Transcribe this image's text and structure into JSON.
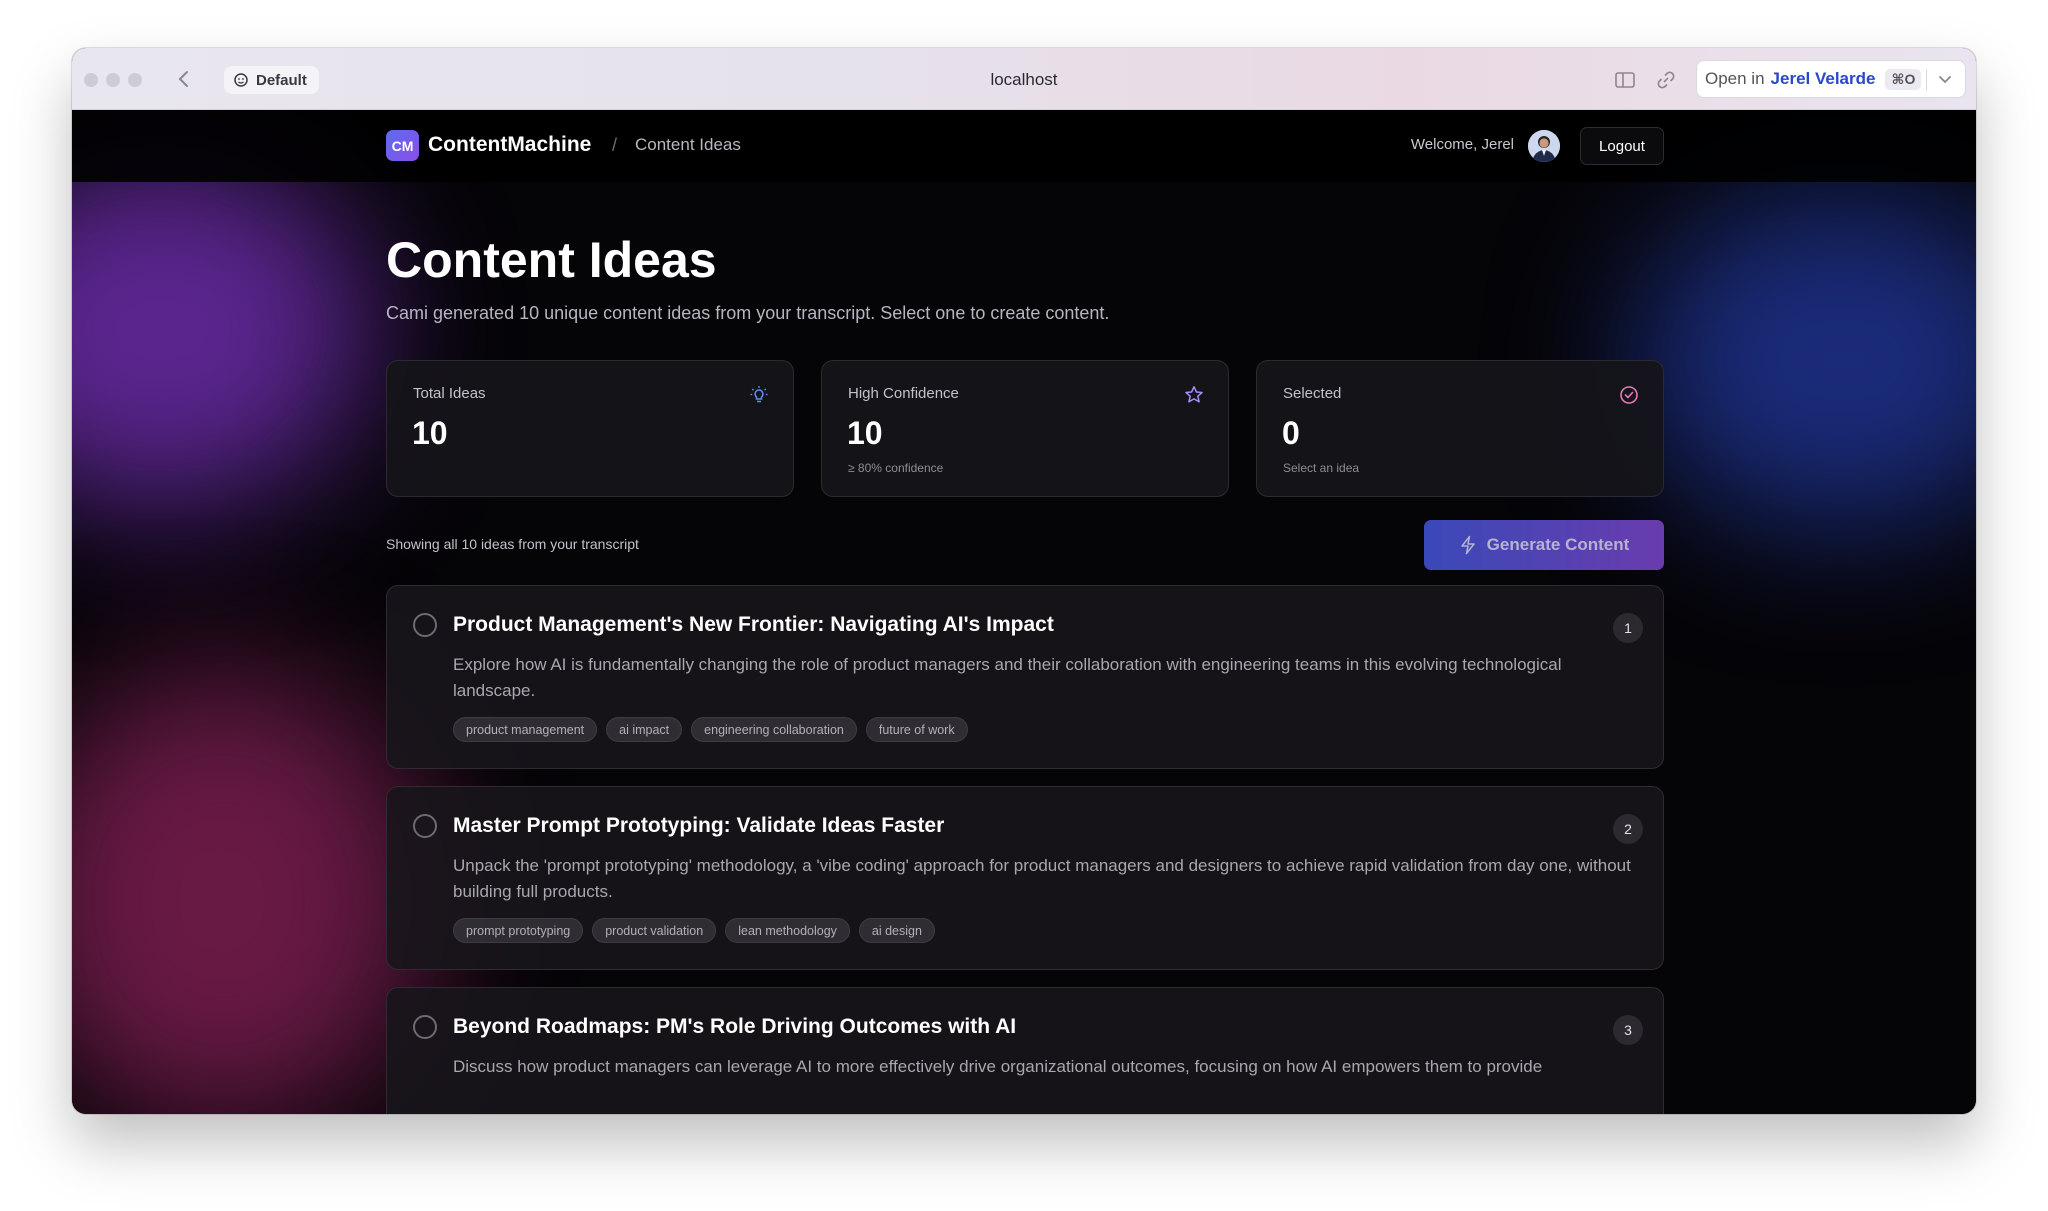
{
  "browser": {
    "profile_label": "Default",
    "url": "localhost",
    "open_in_prefix": "Open in",
    "open_in_name": "Jerel Velarde",
    "open_in_shortcut": "⌘O"
  },
  "header": {
    "logo_text": "CM",
    "brand": "ContentMachine",
    "separator": "/",
    "breadcrumb": "Content Ideas",
    "welcome": "Welcome, Jerel",
    "logout_label": "Logout"
  },
  "page": {
    "title": "Content Ideas",
    "subtitle": "Cami generated 10 unique content ideas from your transcript. Select one to create content."
  },
  "stats": [
    {
      "label": "Total Ideas",
      "value": "10",
      "note": "",
      "icon": "lightbulb-icon",
      "icon_color": "#5b8def"
    },
    {
      "label": "High Confidence",
      "value": "10",
      "note": "≥ 80% confidence",
      "icon": "star-icon",
      "icon_color": "#a78bfa"
    },
    {
      "label": "Selected",
      "value": "0",
      "note": "Select an idea",
      "icon": "check-circle-icon",
      "icon_color": "#e879b9"
    }
  ],
  "toolbar": {
    "showing_text": "Showing all 10 ideas from your transcript",
    "generate_label": "Generate Content"
  },
  "ideas": [
    {
      "number": "1",
      "title": "Product Management's New Frontier: Navigating AI's Impact",
      "description": "Explore how AI is fundamentally changing the role of product managers and their collaboration with engineering teams in this evolving technological landscape.",
      "tags": [
        "product management",
        "ai impact",
        "engineering collaboration",
        "future of work"
      ]
    },
    {
      "number": "2",
      "title": "Master Prompt Prototyping: Validate Ideas Faster",
      "description": "Unpack the 'prompt prototyping' methodology, a 'vibe coding' approach for product managers and designers to achieve rapid validation from day one, without building full products.",
      "tags": [
        "prompt prototyping",
        "product validation",
        "lean methodology",
        "ai design"
      ]
    },
    {
      "number": "3",
      "title": "Beyond Roadmaps: PM's Role Driving Outcomes with AI",
      "description": "Discuss how product managers can leverage AI to more effectively drive organizational outcomes, focusing on how AI empowers them to provide",
      "tags": []
    }
  ],
  "colors": {
    "accent_gradient_start": "#3a49b8",
    "accent_gradient_end": "#6a3cae",
    "background": "#050407"
  }
}
